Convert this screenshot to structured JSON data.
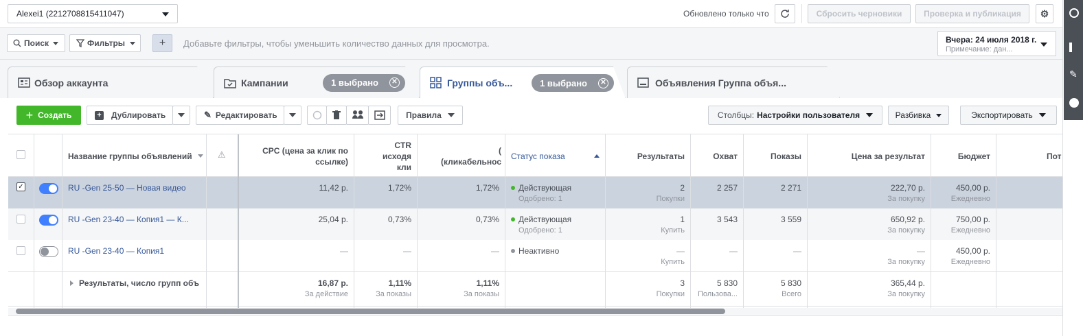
{
  "account": {
    "name": "Alexei1 (2212708815411047)"
  },
  "top": {
    "status": "Обновлено только что",
    "discard": "Сбросить черновики",
    "publish": "Проверка и публикация"
  },
  "filters": {
    "search": "Поиск",
    "filters": "Фильтры",
    "add": "+",
    "hint": "Добавьте фильтры, чтобы уменьшить количество данных для просмотра.",
    "date": "Вчера: 24 июля 2018 г.",
    "date_note": "Примечание: дан..."
  },
  "tabs": [
    {
      "label": "Обзор аккаунта"
    },
    {
      "label": "Кампании",
      "pill": "1 выбрано"
    },
    {
      "label": "Группы объ...",
      "pill": "1 выбрано"
    },
    {
      "label": "Объявления Группа объя..."
    }
  ],
  "toolbar": {
    "create": "Создать",
    "duplicate": "Дублировать",
    "edit": "Редактировать",
    "rules": "Правила",
    "columns_prefix": "Столбцы:",
    "columns_value": "Настройки пользователя",
    "breakdown": "Разбивка",
    "export": "Экспортировать"
  },
  "columns": {
    "name": "Название группы объявлений",
    "cpc": "CPC (цена за клик по ссылке)",
    "ctr1": [
      "CTR",
      "исходя",
      "кли"
    ],
    "ctr2": [
      "(",
      "(кликабельнос"
    ],
    "status": "Статус показа",
    "results": "Результаты",
    "reach": "Охват",
    "impressions": "Показы",
    "cost": "Цена за результат",
    "budget": "Бюджет",
    "po": "Пот"
  },
  "rows": [
    {
      "name": "RU -Gen 25-50 — Новая видео",
      "cpc": "11,42 р.",
      "ctr1": "1,72%",
      "ctr2": "1,72%",
      "status": "Действующая",
      "status_sub": "Одобрено: 1",
      "status_color": "#42b72a",
      "results": "2",
      "results_sub": "Покупки",
      "reach": "2 257",
      "impressions": "2 271",
      "cost": "222,70 р.",
      "cost_sub": "За покупку",
      "budget": "450,00 р.",
      "budget_sub": "Ежедневно"
    },
    {
      "name": "RU -Gen 23-40 — Копия1 — К...",
      "cpc": "25,04 р.",
      "ctr1": "0,73%",
      "ctr2": "0,73%",
      "status": "Действующая",
      "status_sub": "Одобрено: 1",
      "status_color": "#42b72a",
      "results": "1",
      "results_sub": "Купить",
      "reach": "3 543",
      "impressions": "3 559",
      "cost": "650,92 р.",
      "cost_sub": "За покупку",
      "budget": "750,00 р.",
      "budget_sub": "Ежедневно"
    },
    {
      "name": "RU -Gen 23-40 — Копия1",
      "cpc": "—",
      "ctr1": "—",
      "ctr2": "—",
      "status": "Неактивно",
      "status_sub": "",
      "status_color": "#90949c",
      "results": "—",
      "results_sub": "Купить",
      "reach": "—",
      "impressions": "—",
      "cost": "—",
      "cost_sub": "За покупку",
      "budget": "450,00 р.",
      "budget_sub": "Ежедневно"
    }
  ],
  "totals": {
    "label": "Результаты, число групп объ",
    "cpc": "16,87 р.",
    "cpc_sub": "За действие",
    "ctr1": "1,11%",
    "ctr1_sub": "За показы",
    "ctr2": "1,11%",
    "ctr2_sub": "За показы",
    "results": "3",
    "results_sub": "Покупки",
    "reach": "5 830",
    "reach_sub": "Пользова...",
    "impressions": "5 830",
    "impressions_sub": "Всего",
    "cost": "365,44 р.",
    "cost_sub": "За покупку"
  }
}
